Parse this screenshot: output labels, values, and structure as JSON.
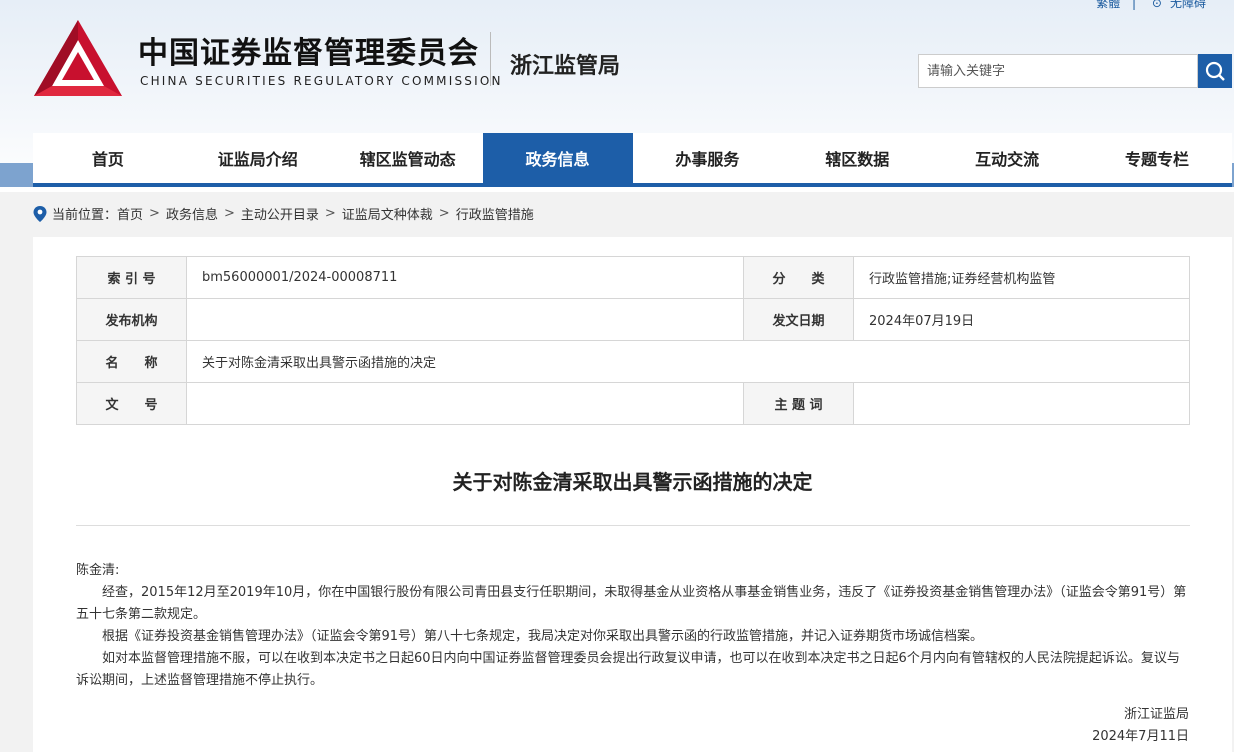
{
  "top_links": {
    "traditional": "繁體",
    "separator": "|",
    "accessible": "无障碍"
  },
  "header": {
    "title_cn": "中国证券监督管理委员会",
    "title_en": "CHINA SECURITIES REGULATORY COMMISSION",
    "bureau": "浙江监管局",
    "search_placeholder": "请输入关键字"
  },
  "nav": {
    "items": [
      {
        "label": "首页"
      },
      {
        "label": "证监局介绍"
      },
      {
        "label": "辖区监管动态"
      },
      {
        "label": "政务信息"
      },
      {
        "label": "办事服务"
      },
      {
        "label": "辖区数据"
      },
      {
        "label": "互动交流"
      },
      {
        "label": "专题专栏"
      }
    ],
    "active": "政务信息"
  },
  "breadcrumb": {
    "prefix": "当前位置：",
    "items": [
      "首页",
      "政务信息",
      "主动公开目录",
      "证监局文种体裁",
      "行政监管措施"
    ],
    "separator": ">"
  },
  "meta": {
    "index_label": "索 引 号",
    "index_value": "bm56000001/2024-00008711",
    "category_label": "分　　类",
    "category_value": "行政监管措施;证券经营机构监管",
    "publisher_label": "发布机构",
    "publisher_value": "",
    "date_label": "发文日期",
    "date_value": "2024年07月19日",
    "name_label": "名　　称",
    "name_value": "关于对陈金清采取出具警示函措施的决定",
    "docno_label": "文　　号",
    "docno_value": "",
    "subject_label": "主 题 词",
    "subject_value": ""
  },
  "document": {
    "title": "关于对陈金清采取出具警示函措施的决定",
    "salutation": "陈金清:",
    "paragraphs": [
      "经查，2015年12月至2019年10月，你在中国银行股份有限公司青田县支行任职期间，未取得基金从业资格从事基金销售业务，违反了《证券投资基金销售管理办法》（证监会令第91号）第五十七条第二款规定。",
      "根据《证券投资基金销售管理办法》（证监会令第91号）第八十七条规定，我局决定对你采取出具警示函的行政监管措施，并记入证券期货市场诚信档案。",
      "如对本监督管理措施不服，可以在收到本决定书之日起60日内向中国证券监督管理委员会提出行政复议申请，也可以在收到本决定书之日起6个月内向有管辖权的人民法院提起诉讼。复议与诉讼期间，上述监督管理措施不停止执行。"
    ],
    "signature": "浙江证监局",
    "sign_date": "2024年7月11日"
  },
  "colors": {
    "brand_blue": "#1d5ea8",
    "logo_red": "#c8102e"
  }
}
